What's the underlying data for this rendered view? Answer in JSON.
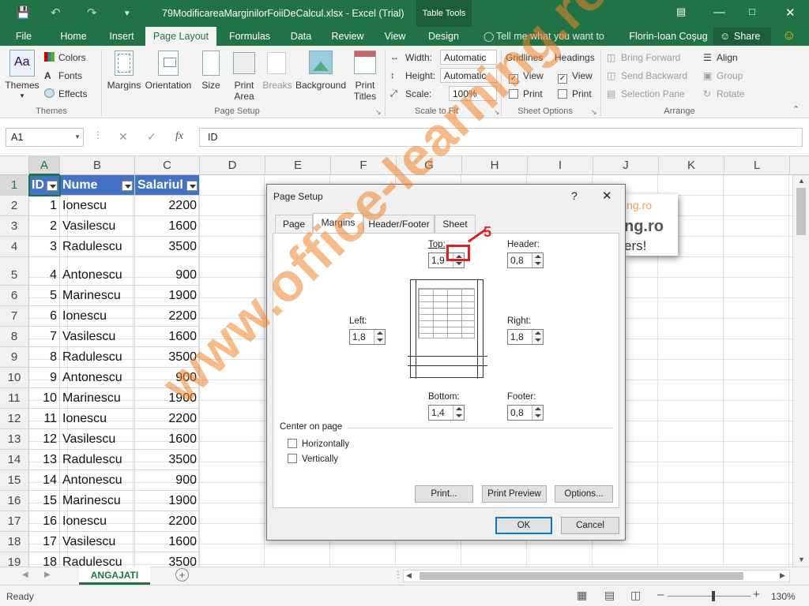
{
  "titlebar": {
    "filename": "79ModificareaMarginilorFoiiDeCalcul.xlsx - Excel (Trial)",
    "contextual": "Table Tools"
  },
  "tabs": {
    "file": "File",
    "home": "Home",
    "insert": "Insert",
    "page_layout": "Page Layout",
    "formulas": "Formulas",
    "data": "Data",
    "review": "Review",
    "view": "View",
    "design": "Design",
    "tellme": "Tell me what you want to do...",
    "user": "Florin-Ioan Coşug",
    "share": "Share"
  },
  "ribbon": {
    "themes": "Themes",
    "colors": "Colors",
    "fonts": "Fonts",
    "effects": "Effects",
    "themes_group": "Themes",
    "margins": "Margins",
    "orientation": "Orientation",
    "size": "Size",
    "print_area_1": "Print",
    "print_area_2": "Area",
    "breaks": "Breaks",
    "background": "Background",
    "print_titles_1": "Print",
    "print_titles_2": "Titles",
    "page_setup_group": "Page Setup",
    "width_label": "Width:",
    "width_value": "Automatic",
    "height_label": "Height:",
    "height_value": "Automatic",
    "scale_label": "Scale:",
    "scale_value": "100%",
    "scale_group": "Scale to Fit",
    "gridlines": "Gridlines",
    "gridlines_view": "View",
    "gridlines_print": "Print",
    "headings": "Headings",
    "headings_view": "View",
    "headings_print": "Print",
    "sheet_options_group": "Sheet Options",
    "bring_forward": "Bring Forward",
    "send_backward": "Send Backward",
    "selection_pane": "Selection Pane",
    "align": "Align",
    "group": "Group",
    "rotate": "Rotate",
    "arrange_group": "Arrange"
  },
  "formula_bar": {
    "name_box": "A1",
    "fx": "fx",
    "content": "ID"
  },
  "columns": [
    "A",
    "B",
    "C",
    "D",
    "E",
    "F",
    "G",
    "H",
    "I",
    "J",
    "K",
    "L"
  ],
  "table": {
    "headers": [
      "ID",
      "Nume",
      "Salariul"
    ],
    "rows": [
      [
        "1",
        "Ionescu",
        "2200"
      ],
      [
        "2",
        "Vasilescu",
        "1600"
      ],
      [
        "3",
        "Radulescu",
        "3500"
      ],
      [
        "4",
        "Antonescu",
        "900"
      ],
      [
        "5",
        "Marinescu",
        "1900"
      ],
      [
        "6",
        "Ionescu",
        "2200"
      ],
      [
        "7",
        "Vasilescu",
        "1600"
      ],
      [
        "8",
        "Radulescu",
        "3500"
      ],
      [
        "9",
        "Antonescu",
        "900"
      ],
      [
        "10",
        "Marinescu",
        "1900"
      ],
      [
        "11",
        "Ionescu",
        "2200"
      ],
      [
        "12",
        "Vasilescu",
        "1600"
      ],
      [
        "13",
        "Radulescu",
        "3500"
      ],
      [
        "14",
        "Antonescu",
        "900"
      ],
      [
        "15",
        "Marinescu",
        "1900"
      ],
      [
        "16",
        "Ionescu",
        "2200"
      ],
      [
        "17",
        "Vasilescu",
        "1600"
      ],
      [
        "18",
        "Radulescu",
        "3500"
      ]
    ]
  },
  "row_numbers": [
    "1",
    "2",
    "3",
    "4",
    "5",
    "6",
    "7",
    "8",
    "9",
    "10",
    "11",
    "12",
    "13",
    "14",
    "15",
    "16",
    "17",
    "18",
    "19"
  ],
  "behind_dialog": {
    "line1": "ing.ro",
    "line2": "ng.ro",
    "line3": "ers!"
  },
  "dialog": {
    "title": "Page Setup",
    "help": "?",
    "tabs": [
      "Page",
      "Margins",
      "Header/Footer",
      "Sheet"
    ],
    "top_label": "Top:",
    "top_value": "1,9",
    "header_label": "Header:",
    "header_value": "0,8",
    "left_label": "Left:",
    "left_value": "1,8",
    "right_label": "Right:",
    "right_value": "1,8",
    "bottom_label": "Bottom:",
    "bottom_value": "1,4",
    "footer_label": "Footer:",
    "footer_value": "0,8",
    "center_on_page": "Center on page",
    "horizontally": "Horizontally",
    "vertically": "Vertically",
    "print_btn": "Print...",
    "print_preview_btn": "Print Preview",
    "options_btn": "Options...",
    "ok": "OK",
    "cancel": "Cancel",
    "step_marker": "5"
  },
  "sheet_tab": "ANGAJATI",
  "status": {
    "ready": "Ready",
    "zoom": "130%"
  },
  "watermark": "www.office-learning.ro",
  "colors": {
    "excel_green": "#217346",
    "table_header": "#4472c4",
    "callout": "#e02020",
    "watermark": "#f08228"
  }
}
